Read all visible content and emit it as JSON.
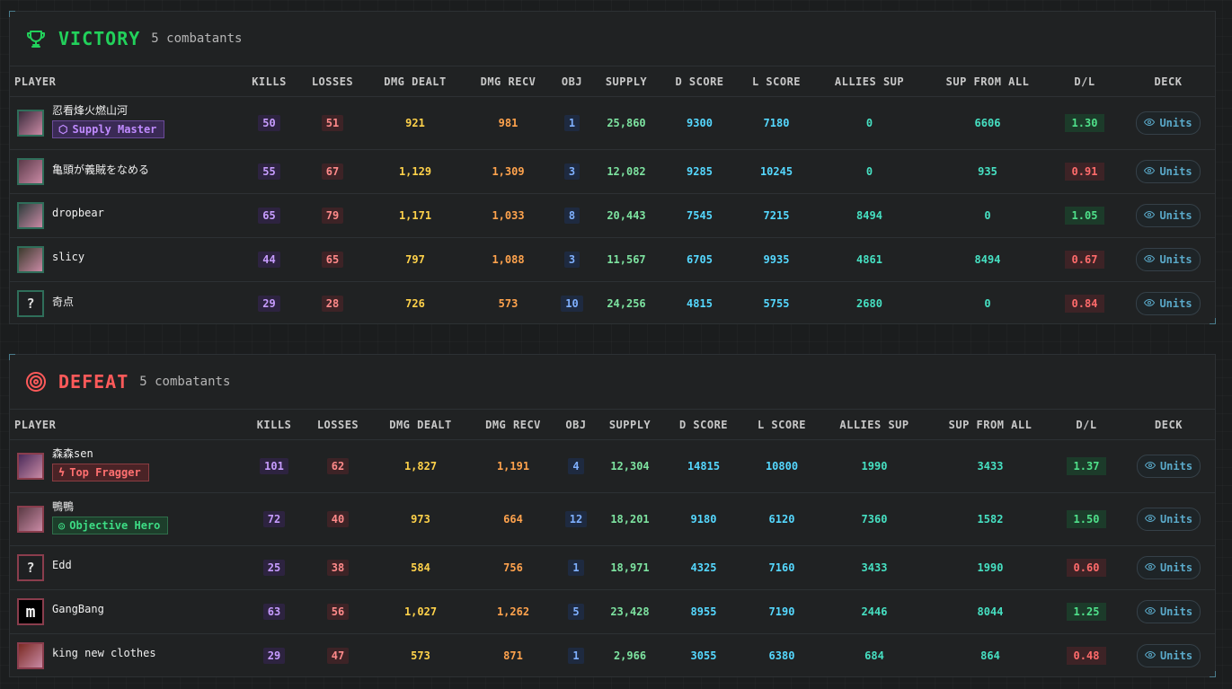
{
  "columns": [
    "PLAYER",
    "KILLS",
    "LOSSES",
    "DMG DEALT",
    "DMG RECV",
    "OBJ",
    "SUPPLY",
    "D SCORE",
    "L SCORE",
    "ALLIES SUP",
    "SUP FROM ALL",
    "D/L",
    "DECK"
  ],
  "victory": {
    "title": "VICTORY",
    "count": "5 combatants",
    "icon": "trophy-icon",
    "accent": "#22d15b",
    "rows": [
      {
        "name": "忍看烽火燃山河",
        "badge": "Supply Master",
        "badge_type": "supply",
        "avatar": "anime-avatar",
        "kills": "50",
        "losses": "51",
        "dealt": "921",
        "recv": "981",
        "obj": "1",
        "supply": "25,860",
        "dscore": "9300",
        "lscore": "7180",
        "allies": "0",
        "supall": "6606",
        "dl": "1.30",
        "dl_good": true,
        "deck": "Units"
      },
      {
        "name": "亀頭が義賊をなめる",
        "badge": "",
        "avatar": "anime-avatar",
        "kills": "55",
        "losses": "67",
        "dealt": "1,129",
        "recv": "1,309",
        "obj": "3",
        "supply": "12,082",
        "dscore": "9285",
        "lscore": "10245",
        "allies": "0",
        "supall": "935",
        "dl": "0.91",
        "dl_good": false,
        "deck": "Units"
      },
      {
        "name": "dropbear",
        "badge": "",
        "avatar": "anime-avatar",
        "kills": "65",
        "losses": "79",
        "dealt": "1,171",
        "recv": "1,033",
        "obj": "8",
        "supply": "20,443",
        "dscore": "7545",
        "lscore": "7215",
        "allies": "8494",
        "supall": "0",
        "dl": "1.05",
        "dl_good": true,
        "deck": "Units"
      },
      {
        "name": "slicy",
        "badge": "",
        "avatar": "anime-avatar",
        "kills": "44",
        "losses": "65",
        "dealt": "797",
        "recv": "1,088",
        "obj": "3",
        "supply": "11,567",
        "dscore": "6705",
        "lscore": "9935",
        "allies": "4861",
        "supall": "8494",
        "dl": "0.67",
        "dl_good": false,
        "deck": "Units"
      },
      {
        "name": "奇点",
        "badge": "",
        "avatar": "?",
        "kills": "29",
        "losses": "28",
        "dealt": "726",
        "recv": "573",
        "obj": "10",
        "supply": "24,256",
        "dscore": "4815",
        "lscore": "5755",
        "allies": "2680",
        "supall": "0",
        "dl": "0.84",
        "dl_good": false,
        "deck": "Units"
      }
    ]
  },
  "defeat": {
    "title": "DEFEAT",
    "count": "5 combatants",
    "icon": "target-icon",
    "accent": "#ff5a5a",
    "rows": [
      {
        "name": "森森sen",
        "badge": "Top Fragger",
        "badge_type": "frag",
        "avatar": "anime-avatar",
        "kills": "101",
        "losses": "62",
        "dealt": "1,827",
        "recv": "1,191",
        "obj": "4",
        "supply": "12,304",
        "dscore": "14815",
        "lscore": "10800",
        "allies": "1990",
        "supall": "3433",
        "dl": "1.37",
        "dl_good": true,
        "deck": "Units"
      },
      {
        "name": "鴨鴨",
        "badge": "Objective Hero",
        "badge_type": "obj",
        "avatar": "anime-avatar",
        "kills": "72",
        "losses": "40",
        "dealt": "973",
        "recv": "664",
        "obj": "12",
        "supply": "18,201",
        "dscore": "9180",
        "lscore": "6120",
        "allies": "7360",
        "supall": "1582",
        "dl": "1.50",
        "dl_good": true,
        "deck": "Units"
      },
      {
        "name": "Edd",
        "badge": "",
        "avatar": "?",
        "kills": "25",
        "losses": "38",
        "dealt": "584",
        "recv": "756",
        "obj": "1",
        "supply": "18,971",
        "dscore": "4325",
        "lscore": "7160",
        "allies": "3433",
        "supall": "1990",
        "dl": "0.60",
        "dl_good": false,
        "deck": "Units"
      },
      {
        "name": "GangBang",
        "badge": "",
        "avatar": "m",
        "kills": "63",
        "losses": "56",
        "dealt": "1,027",
        "recv": "1,262",
        "obj": "5",
        "supply": "23,428",
        "dscore": "8955",
        "lscore": "7190",
        "allies": "2446",
        "supall": "8044",
        "dl": "1.25",
        "dl_good": true,
        "deck": "Units"
      },
      {
        "name": "king new clothes",
        "badge": "",
        "avatar": "anime-avatar",
        "kills": "29",
        "losses": "47",
        "dealt": "573",
        "recv": "871",
        "obj": "1",
        "supply": "2,966",
        "dscore": "3055",
        "lscore": "6380",
        "allies": "684",
        "supall": "864",
        "dl": "0.48",
        "dl_good": false,
        "deck": "Units"
      }
    ]
  }
}
